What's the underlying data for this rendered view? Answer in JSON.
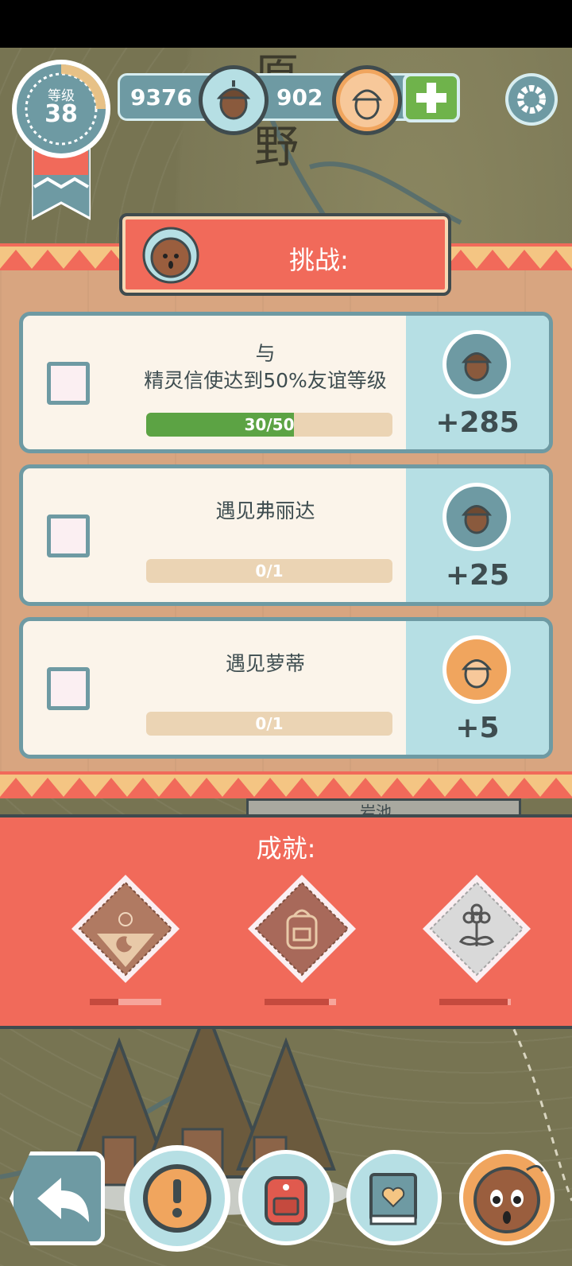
{
  "status_bar": {},
  "map": {
    "labels": [
      "原",
      "野"
    ],
    "bottom_label": "岩池"
  },
  "level": {
    "label": "等级",
    "value": "38"
  },
  "currency": {
    "acorns": "9376",
    "golden_acorns": "902"
  },
  "challenge": {
    "title": "挑战:",
    "tasks": [
      {
        "text_line1": "与",
        "text_line2": "精灵信使达到50%友谊等级",
        "progress_label": "30/50",
        "progress": 0.6,
        "reward": "+285",
        "reward_type": "acorn"
      },
      {
        "text_line1": "遇见弗丽达",
        "progress_label": "0/1",
        "progress": 0,
        "reward": "+25",
        "reward_type": "acorn"
      },
      {
        "text_line1": "遇见萝蒂",
        "progress_label": "0/1",
        "progress": 0,
        "reward": "+5",
        "reward_type": "golden-acorn"
      }
    ]
  },
  "achievements": {
    "title": "成就:",
    "badges": [
      {
        "icon": "sun-moon-icon",
        "progress": 0.4
      },
      {
        "icon": "backpack-icon",
        "progress": 0.9
      },
      {
        "icon": "flower-icon",
        "progress": 0.95
      }
    ]
  },
  "nav": [
    "back-icon",
    "quest-alert-icon",
    "backpack-icon",
    "journal-heart-icon",
    "spirit-character-icon"
  ],
  "colors": {
    "accent_red": "#f16a5a",
    "teal": "#6e9aa3",
    "green": "#6fb34b",
    "gold": "#f0a55e"
  }
}
